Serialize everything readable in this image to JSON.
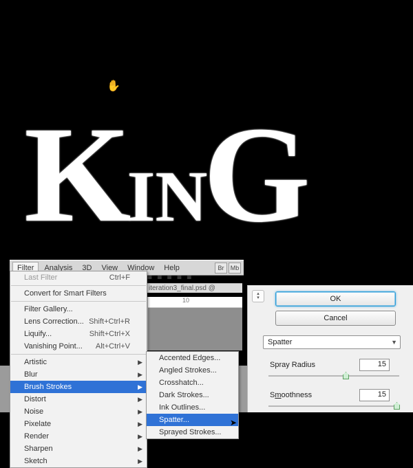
{
  "canvas": {
    "big_text": "KinG",
    "move_cursor": "✋"
  },
  "menubar": {
    "items": [
      "Filter",
      "Analysis",
      "3D",
      "View",
      "Window",
      "Help"
    ],
    "icon_labels": [
      "Br",
      "Mb"
    ]
  },
  "doc": {
    "tab": "iteration3_final.psd @",
    "ruler_mark": "10"
  },
  "filter_menu": {
    "last_filter": {
      "label": "Last Filter",
      "shortcut": "Ctrl+F"
    },
    "convert": "Convert for Smart Filters",
    "gallery": "Filter Gallery...",
    "lens": {
      "label": "Lens Correction...",
      "shortcut": "Shift+Ctrl+R"
    },
    "liquify": {
      "label": "Liquify...",
      "shortcut": "Shift+Ctrl+X"
    },
    "vanishing": {
      "label": "Vanishing Point...",
      "shortcut": "Alt+Ctrl+V"
    },
    "groups": [
      "Artistic",
      "Blur",
      "Brush Strokes",
      "Distort",
      "Noise",
      "Pixelate",
      "Render",
      "Sharpen",
      "Sketch"
    ]
  },
  "brush_strokes": {
    "items": [
      "Accented Edges...",
      "Angled Strokes...",
      "Crosshatch...",
      "Dark Strokes...",
      "Ink Outlines...",
      "Spatter...",
      "Sprayed Strokes..."
    ]
  },
  "dialog": {
    "ok": "OK",
    "cancel": "Cancel",
    "combo": "Spatter",
    "spray_label": "Spray Radius",
    "spray_value": "15",
    "smooth_label_pre": "S",
    "smooth_label_under": "m",
    "smooth_label_post": "oothness",
    "smooth_value": "15"
  }
}
